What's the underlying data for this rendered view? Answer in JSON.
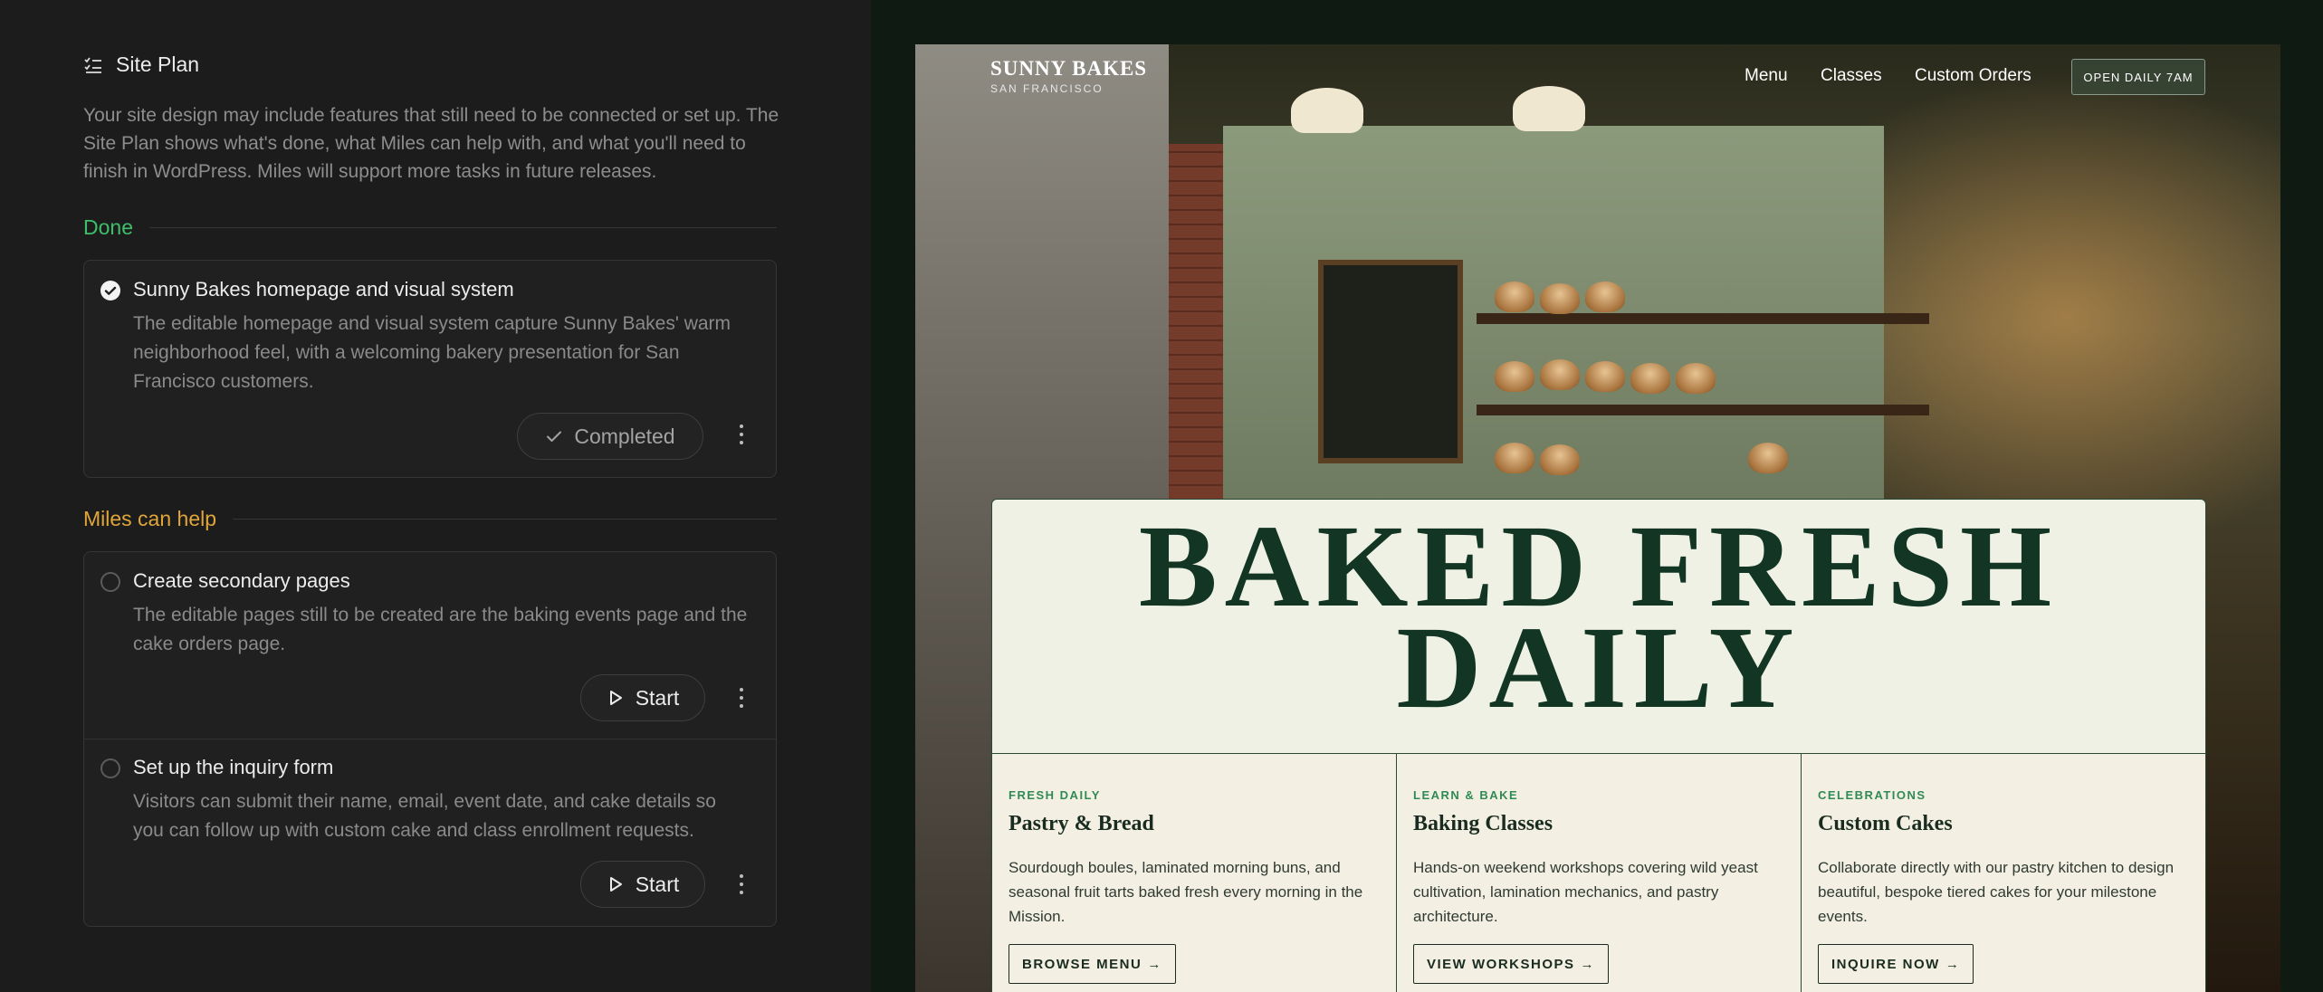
{
  "site_plan": {
    "title": "Site Plan",
    "description": "Your site design may include features that still need to be connected or set up. The Site Plan shows what's done, what Miles can help with, and what you'll need to finish in WordPress. Miles will support more tasks in future releases.",
    "sections": {
      "done": {
        "label": "Done",
        "color": "#3fbf6a",
        "tasks": [
          {
            "title": "Sunny Bakes homepage and visual system",
            "description": "The editable homepage and visual system capture Sunny Bakes' warm neighborhood feel, with a welcoming bakery presentation for San Francisco customers.",
            "action": "Completed"
          }
        ]
      },
      "help": {
        "label": "Miles can help",
        "color": "#e0a63a",
        "tasks": [
          {
            "title": "Create secondary pages",
            "description": "The editable pages still to be created are the baking events page and the cake orders page.",
            "action": "Start"
          },
          {
            "title": "Set up the inquiry form",
            "description": "Visitors can submit their name, email, event date, and cake details so you can follow up with custom cake and class enrollment requests.",
            "action": "Start"
          }
        ]
      }
    }
  },
  "preview": {
    "brand": {
      "name": "SUNNY BAKES",
      "subtitle": "SAN FRANCISCO"
    },
    "nav": [
      "Menu",
      "Classes",
      "Custom Orders"
    ],
    "hours_badge": "OPEN DAILY 7AM",
    "hero_title_line1": "BAKED FRESH",
    "hero_title_line2": "DAILY",
    "columns": [
      {
        "kicker": "FRESH DAILY",
        "title": "Pastry & Bread",
        "body": "Sourdough boules, laminated morning buns, and seasonal fruit tarts baked fresh every morning in the Mission.",
        "button": "BROWSE MENU"
      },
      {
        "kicker": "LEARN & BAKE",
        "title": "Baking Classes",
        "body": "Hands-on weekend workshops covering wild yeast cultivation, lamination mechanics, and pastry architecture.",
        "button": "VIEW WORKSHOPS"
      },
      {
        "kicker": "CELEBRATIONS",
        "title": "Custom Cakes",
        "body": "Collaborate directly with our pastry kitchen to design beautiful, bespoke tiered cakes for your milestone events.",
        "button": "INQUIRE NOW"
      }
    ],
    "colors": {
      "hero_text": "#123524",
      "accent_green": "#2f8a55",
      "card_bg": "#eef1e4"
    }
  }
}
